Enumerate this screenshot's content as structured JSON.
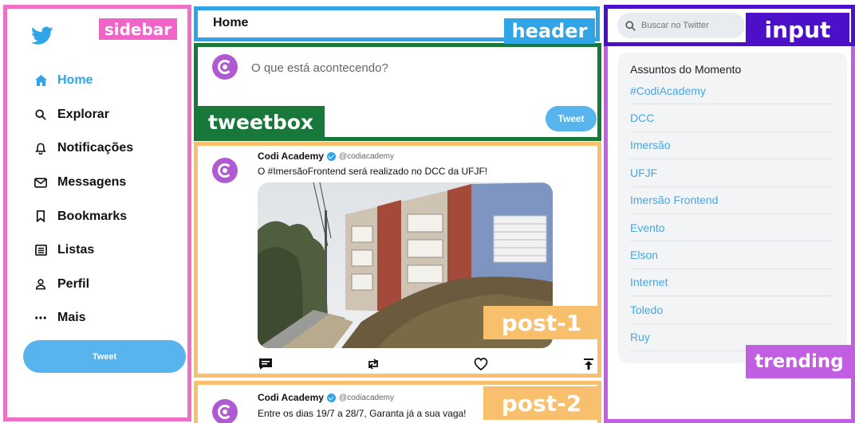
{
  "labels": {
    "sidebar": "sidebar",
    "header": "header",
    "tweetbox": "tweetbox",
    "input": "input",
    "post1": "post-1",
    "post2": "post-2",
    "trending": "trending"
  },
  "colors": {
    "brand": "#2fa4e7",
    "sidebar_outline": "#ef6fc4",
    "header_outline": "#2fa4e7",
    "tweetbox_outline": "#17783a",
    "post_outline": "#f8c06c",
    "input_outline": "#4d10c9",
    "trending_outline": "#c25ee2"
  },
  "sidebar": {
    "logo_icon": "twitter-bird-icon",
    "items": [
      {
        "label": "Home",
        "icon": "home-icon"
      },
      {
        "label": "Explorar",
        "icon": "search-icon"
      },
      {
        "label": "Notificações",
        "icon": "bell-icon"
      },
      {
        "label": "Messagens",
        "icon": "envelope-icon"
      },
      {
        "label": "Bookmarks",
        "icon": "bookmark-icon"
      },
      {
        "label": "Listas",
        "icon": "list-icon"
      },
      {
        "label": "Perfil",
        "icon": "person-icon"
      },
      {
        "label": "Mais",
        "icon": "more-icon"
      }
    ],
    "tweet_button": "Tweet"
  },
  "header": {
    "title": "Home"
  },
  "tweetbox": {
    "placeholder": "O que está acontecendo?",
    "button": "Tweet"
  },
  "posts": [
    {
      "name": "Codi Academy",
      "handle": "@codiacademy",
      "text": "O #ImersãoFrontend será realizado no DCC da UFJF!"
    },
    {
      "name": "Codi Academy",
      "handle": "@codiacademy",
      "text": "Entre os dias 19/7 a 28/7, Garanta já a sua vaga!"
    }
  ],
  "search": {
    "placeholder": "Buscar no Twitter"
  },
  "trending": {
    "title": "Assuntos do Momento",
    "items": [
      "#CodiAcademy",
      "DCC",
      "Imersão",
      "UFJF",
      "Imersão Frontend",
      "Evento",
      "Elson",
      "Internet",
      "Toledo",
      "Ruy"
    ]
  }
}
